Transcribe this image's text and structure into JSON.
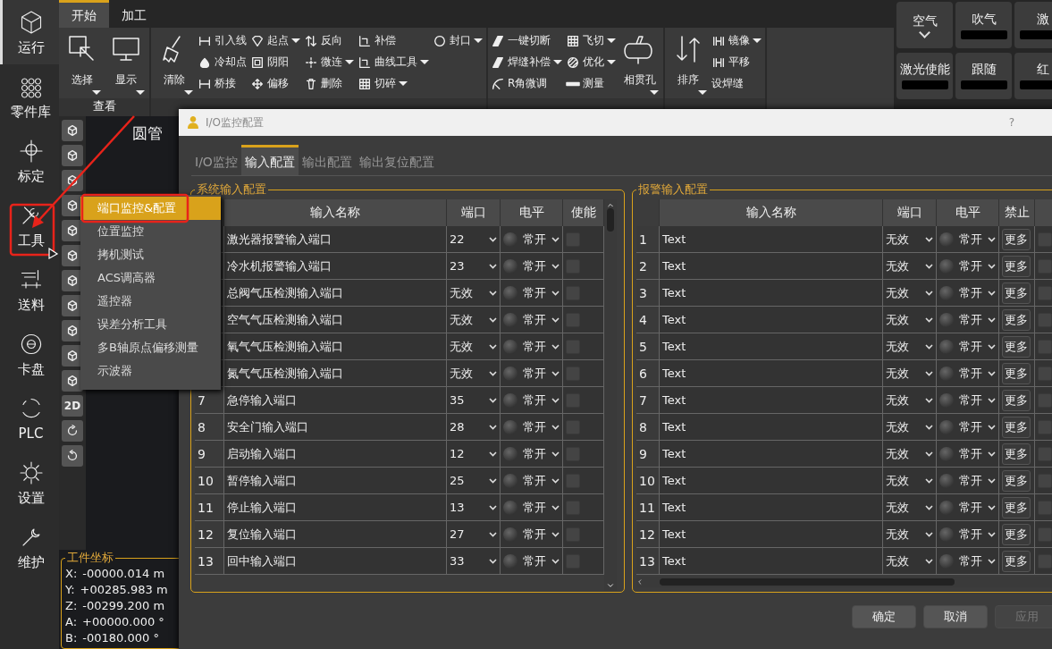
{
  "sidebar": {
    "items": [
      {
        "label": "运行",
        "selected": true
      },
      {
        "label": "零件库",
        "selected": false
      },
      {
        "label": "标定",
        "selected": false
      },
      {
        "label": "工具",
        "selected": false
      },
      {
        "label": "送料",
        "selected": false
      },
      {
        "label": "卡盘",
        "selected": false
      },
      {
        "label": "PLC",
        "selected": false
      },
      {
        "label": "设置",
        "selected": false
      },
      {
        "label": "维护",
        "selected": false
      }
    ]
  },
  "ribbon": {
    "tabs": [
      {
        "label": "开始",
        "selected": true
      },
      {
        "label": "加工",
        "selected": false
      }
    ],
    "groups": [
      {
        "label": "查看",
        "items": [
          {
            "kind": "large",
            "label": "选择",
            "dropdown": true
          },
          {
            "kind": "large",
            "label": "显示",
            "dropdown": true
          }
        ]
      },
      {
        "items": [
          {
            "kind": "large",
            "label": "清除",
            "dropdown": true
          },
          {
            "kind": "column",
            "items": [
              {
                "label": "引入线",
                "dropdown": false
              },
              {
                "label": "冷却点",
                "dropdown": false
              },
              {
                "label": "桥接",
                "dropdown": false
              }
            ]
          },
          {
            "kind": "column",
            "items": [
              {
                "label": "起点",
                "dropdown": true
              },
              {
                "label": "阴阳",
                "dropdown": false
              },
              {
                "label": "偏移",
                "dropdown": false
              }
            ]
          },
          {
            "kind": "column",
            "items": [
              {
                "label": "反向",
                "dropdown": false
              },
              {
                "label": "微连",
                "dropdown": true
              },
              {
                "label": "删除",
                "dropdown": false
              }
            ]
          },
          {
            "kind": "column",
            "items": [
              {
                "label": "补偿",
                "dropdown": false
              },
              {
                "label": "曲线工具",
                "dropdown": true
              },
              {
                "label": "切碎",
                "dropdown": true
              }
            ]
          },
          {
            "kind": "column",
            "items": [
              {
                "label": "封口",
                "dropdown": true
              }
            ]
          }
        ]
      },
      {
        "items": [
          {
            "kind": "column",
            "items": [
              {
                "label": "一键切断",
                "dropdown": false
              },
              {
                "label": "焊缝补偿",
                "dropdown": true
              },
              {
                "label": "R角微调",
                "dropdown": false
              }
            ]
          },
          {
            "kind": "column",
            "items": [
              {
                "label": "飞切",
                "dropdown": true
              },
              {
                "label": "优化",
                "dropdown": true
              },
              {
                "label": "测量",
                "dropdown": false
              }
            ]
          },
          {
            "kind": "large",
            "label": "相贯孔",
            "dropdown": true
          }
        ]
      },
      {
        "items": [
          {
            "kind": "large",
            "label": "排序",
            "dropdown": true
          },
          {
            "kind": "column",
            "items": [
              {
                "label": "镜像",
                "dropdown": true
              },
              {
                "label": "平移",
                "dropdown": false
              },
              {
                "label": "设焊缝",
                "dropdown": false
              }
            ]
          }
        ]
      }
    ],
    "quick_buttons": [
      {
        "label": "空气",
        "kind": "dropdown"
      },
      {
        "label": "吹气",
        "kind": "indicator"
      },
      {
        "label": "激",
        "kind": "indicator"
      },
      {
        "label": "激光使能",
        "kind": "indicator"
      },
      {
        "label": "跟随",
        "kind": "indicator"
      },
      {
        "label": "红",
        "kind": "indicator"
      }
    ]
  },
  "view_toolbar": {
    "items": [
      {
        "kind": "cube"
      },
      {
        "kind": "cube"
      },
      {
        "kind": "cube"
      },
      {
        "kind": "cube"
      },
      {
        "kind": "cube"
      },
      {
        "kind": "cube"
      },
      {
        "kind": "cube"
      },
      {
        "kind": "cube"
      },
      {
        "kind": "cube"
      },
      {
        "kind": "cube"
      },
      {
        "kind": "cube"
      },
      {
        "kind": "text",
        "label": "2D"
      },
      {
        "kind": "rotate_cw"
      },
      {
        "kind": "rotate_ccw"
      }
    ]
  },
  "canvas": {
    "title": "圆管"
  },
  "coordinates": {
    "title": "工件坐标",
    "rows": [
      {
        "axis": "X:",
        "value": "-00000.014 m"
      },
      {
        "axis": "Y:",
        "value": "+00285.983 m"
      },
      {
        "axis": "Z:",
        "value": "-00299.200 m"
      },
      {
        "axis": "A:",
        "value": "+00000.000 °"
      },
      {
        "axis": "B:",
        "value": "-00180.000 °"
      }
    ]
  },
  "tools_menu": {
    "items": [
      {
        "label": "端口监控&配置",
        "selected": true
      },
      {
        "label": "位置监控",
        "selected": false
      },
      {
        "label": "拷机测试",
        "selected": false
      },
      {
        "label": "ACS调高器",
        "selected": false
      },
      {
        "label": "遥控器",
        "selected": false
      },
      {
        "label": "误差分析工具",
        "selected": false
      },
      {
        "label": "多B轴原点偏移测量",
        "selected": false
      },
      {
        "label": "示波器",
        "selected": false
      }
    ]
  },
  "dialog": {
    "title": "I/O监控配置",
    "help": "?",
    "tabs": [
      {
        "label": "I/O监控",
        "selected": false
      },
      {
        "label": "输入配置",
        "selected": true
      },
      {
        "label": "输出配置",
        "selected": false
      },
      {
        "label": "输出复位配置",
        "selected": false
      }
    ],
    "system_inputs": {
      "title": "系统输入配置",
      "columns": [
        "输入名称",
        "端口",
        "电平",
        "使能"
      ],
      "rows": [
        {
          "name": "激光器报警输入端口",
          "port": "22",
          "polarity": "常开",
          "enabled": false
        },
        {
          "name": "冷水机报警输入端口",
          "port": "23",
          "polarity": "常开",
          "enabled": false
        },
        {
          "name": "总阀气压检测输入端口",
          "port": "无效",
          "polarity": "常开",
          "enabled": false
        },
        {
          "name": "空气气压检测输入端口",
          "port": "无效",
          "polarity": "常开",
          "enabled": false
        },
        {
          "name": "氧气气压检测输入端口",
          "port": "无效",
          "polarity": "常开",
          "enabled": false
        },
        {
          "name": "氮气气压检测输入端口",
          "port": "无效",
          "polarity": "常开",
          "enabled": false
        },
        {
          "no": "7",
          "name": "急停输入端口",
          "port": "35",
          "polarity": "常开",
          "enabled": false
        },
        {
          "no": "8",
          "name": "安全门输入端口",
          "port": "28",
          "polarity": "常开",
          "enabled": false
        },
        {
          "no": "9",
          "name": "启动输入端口",
          "port": "12",
          "polarity": "常开",
          "enabled": false
        },
        {
          "no": "10",
          "name": "暂停输入端口",
          "port": "25",
          "polarity": "常开",
          "enabled": false
        },
        {
          "no": "11",
          "name": "停止输入端口",
          "port": "13",
          "polarity": "常开",
          "enabled": false
        },
        {
          "no": "12",
          "name": "复位输入端口",
          "port": "27",
          "polarity": "常开",
          "enabled": false
        },
        {
          "no": "13",
          "name": "回中输入端口",
          "port": "33",
          "polarity": "常开",
          "enabled": false
        }
      ]
    },
    "alarm_inputs": {
      "title": "报警输入配置",
      "columns": [
        "输入名称",
        "端口",
        "电平",
        "禁止"
      ],
      "rows": [
        {
          "no": "1",
          "name": "Text",
          "port": "无效",
          "polarity": "常开",
          "more": "更多",
          "checked": false
        },
        {
          "no": "2",
          "name": "Text",
          "port": "无效",
          "polarity": "常开",
          "more": "更多",
          "checked": false
        },
        {
          "no": "3",
          "name": "Text",
          "port": "无效",
          "polarity": "常开",
          "more": "更多",
          "checked": false
        },
        {
          "no": "4",
          "name": "Text",
          "port": "无效",
          "polarity": "常开",
          "more": "更多",
          "checked": false
        },
        {
          "no": "5",
          "name": "Text",
          "port": "无效",
          "polarity": "常开",
          "more": "更多",
          "checked": false
        },
        {
          "no": "6",
          "name": "Text",
          "port": "无效",
          "polarity": "常开",
          "more": "更多",
          "checked": false
        },
        {
          "no": "7",
          "name": "Text",
          "port": "无效",
          "polarity": "常开",
          "more": "更多",
          "checked": false
        },
        {
          "no": "8",
          "name": "Text",
          "port": "无效",
          "polarity": "常开",
          "more": "更多",
          "checked": false
        },
        {
          "no": "9",
          "name": "Text",
          "port": "无效",
          "polarity": "常开",
          "more": "更多",
          "checked": false
        },
        {
          "no": "10",
          "name": "Text",
          "port": "无效",
          "polarity": "常开",
          "more": "更多",
          "checked": false
        },
        {
          "no": "11",
          "name": "Text",
          "port": "无效",
          "polarity": "常开",
          "more": "更多",
          "checked": false
        },
        {
          "no": "12",
          "name": "Text",
          "port": "无效",
          "polarity": "常开",
          "more": "更多",
          "checked": false
        },
        {
          "no": "13",
          "name": "Text",
          "port": "无效",
          "polarity": "常开",
          "more": "更多",
          "checked": false
        }
      ]
    },
    "buttons": [
      {
        "label": "确定",
        "disabled": false
      },
      {
        "label": "取消",
        "disabled": false
      },
      {
        "label": "应用",
        "disabled": true
      }
    ]
  }
}
